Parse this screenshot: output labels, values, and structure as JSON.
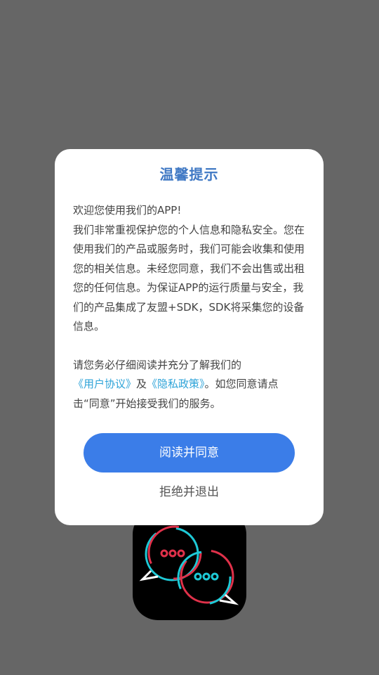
{
  "dialog": {
    "title": "温馨提示",
    "greeting": "欢迎您使用我们的APP!",
    "paragraph1": "我们非常重视保护您的个人信息和隐私安全。您在使用我们的产品或服务时，我们可能会收集和使用您的相关信息。未经您同意，我们不会出售或出租您的任何信息。为保证APP的运行质量与安全，我们的产品集成了友盟+SDK，SDK将采集您的设备信息。",
    "paragraph2_prefix": "请您务必仔细阅读并充分了解我们的",
    "user_agreement_link": "《用户协议》",
    "conjunction": "及",
    "privacy_policy_link": "《隐私政策》",
    "paragraph2_suffix": "。如您同意请点击“同意”开始接受我们的服务。",
    "agree_button": "阅读并同意",
    "reject_button": "拒绝并退出"
  },
  "colors": {
    "overlay": "#666666",
    "title": "#3f78c4",
    "link": "#2da3d8",
    "primary_button": "#3b7de8"
  },
  "icons": {
    "app_icon": "chat-bubbles-icon"
  }
}
